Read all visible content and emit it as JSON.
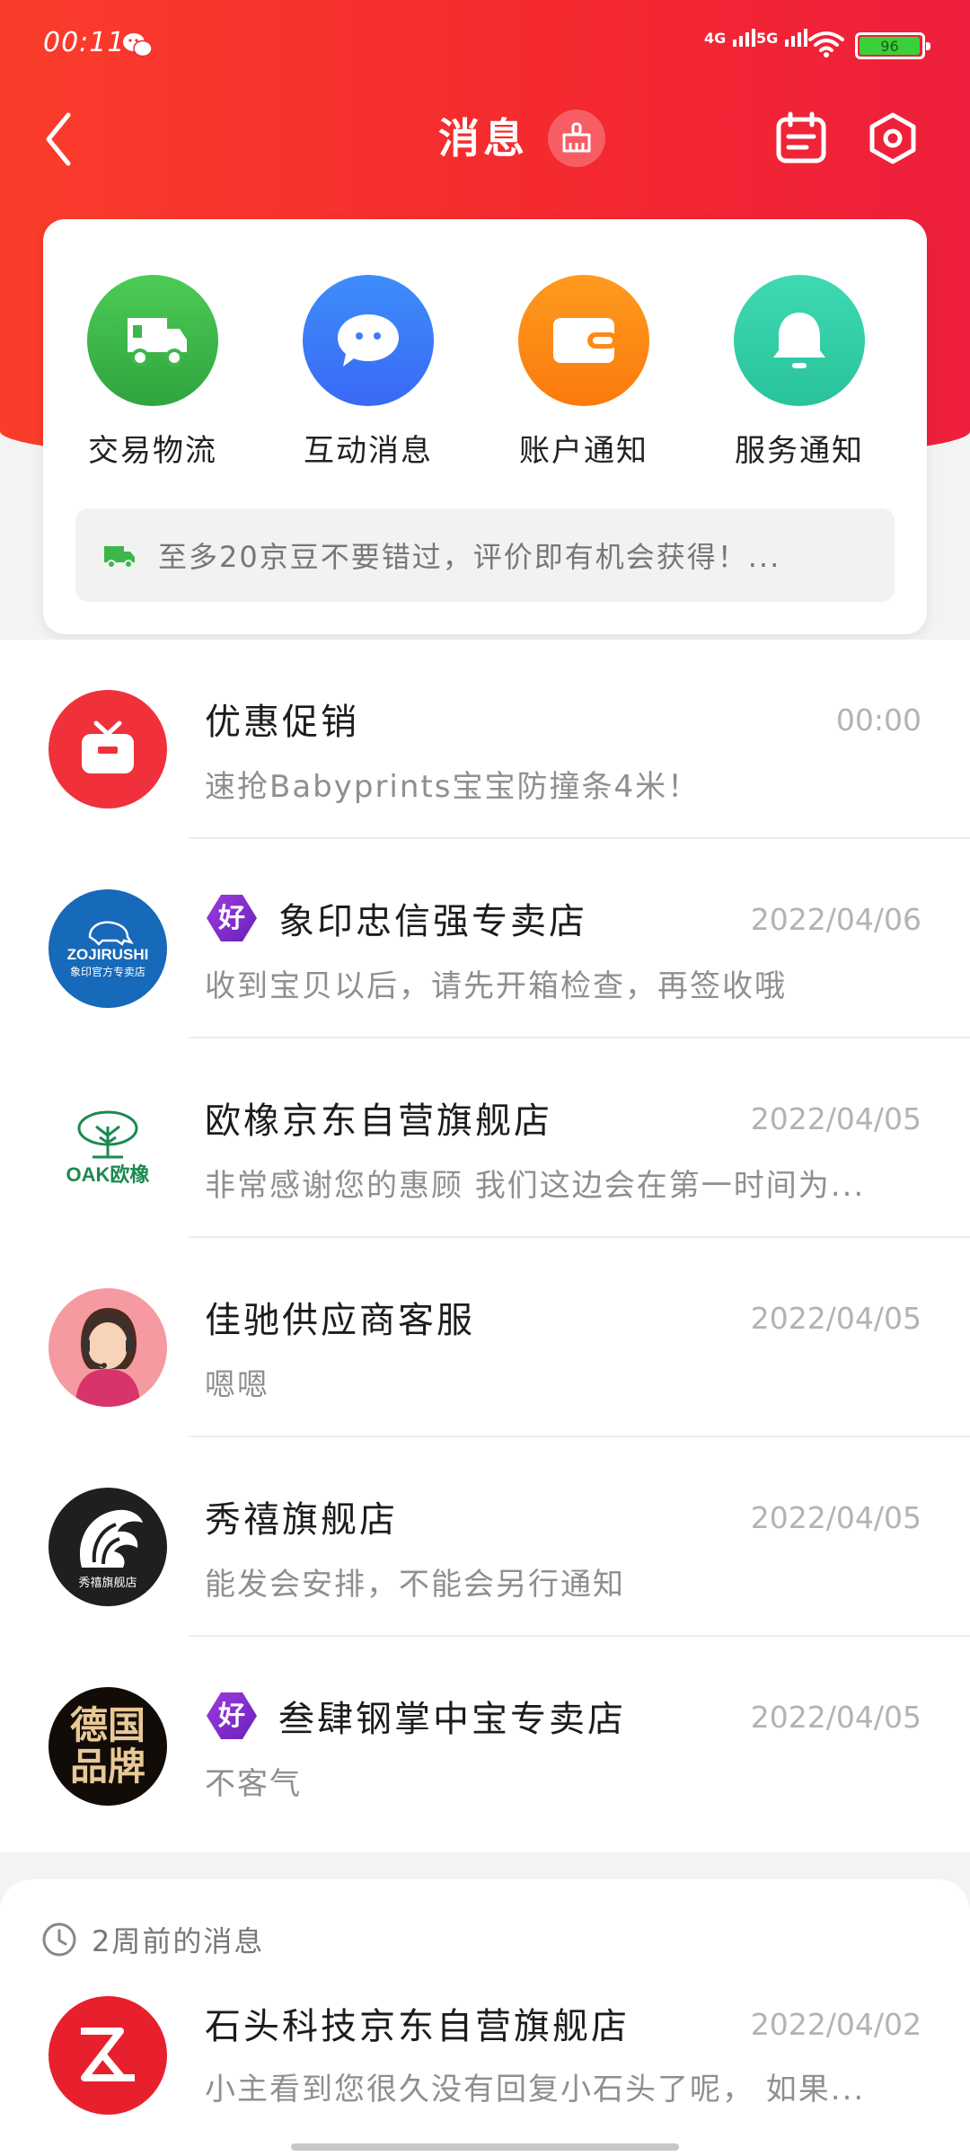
{
  "status_bar": {
    "time": "00:11",
    "network_1": "4G",
    "network_2": "5G",
    "battery": "96"
  },
  "nav": {
    "title": "消息"
  },
  "categories": [
    {
      "label": "交易物流",
      "icon": "truck-icon",
      "color": "#3cb84a"
    },
    {
      "label": "互动消息",
      "icon": "chat-bubble-icon",
      "color": "#3b7ef8"
    },
    {
      "label": "账户通知",
      "icon": "wallet-icon",
      "color": "#fd8a12"
    },
    {
      "label": "服务通知",
      "icon": "bell-icon",
      "color": "#33cfa8"
    }
  ],
  "notice": {
    "text": "至多20京豆不要错过，评价即有机会获得！..."
  },
  "messages": [
    {
      "name": "优惠促销",
      "time": "00:00",
      "preview": "速抢Babyprints宝宝防撞条4米！",
      "avatar": "gift-icon",
      "badge": false
    },
    {
      "name": "象印忠信强专卖店",
      "time": "2022/04/06",
      "preview": "收到宝贝以后，请先开箱检查，再签收哦",
      "avatar": "zojirushi-logo",
      "avatar_text": "ZOJIRUSHI",
      "avatar_subtext": "象印官方专卖店",
      "badge": true,
      "badge_text": "好"
    },
    {
      "name": "欧橡京东自营旗舰店",
      "time": "2022/04/05",
      "preview": "非常感谢您的惠顾 我们这边会在第一时间为...",
      "avatar": "oak-tree-logo",
      "avatar_text": "OAK欧橡",
      "badge": false
    },
    {
      "name": "佳驰供应商客服",
      "time": "2022/04/05",
      "preview": "嗯嗯",
      "avatar": "customer-service-avatar",
      "badge": false
    },
    {
      "name": "秀禧旗舰店",
      "time": "2022/04/05",
      "preview": "能发会安排，不能会另行通知",
      "avatar": "lion-logo",
      "avatar_text": "秀禧旗舰店",
      "badge": false
    },
    {
      "name": "叁肆钢掌中宝专卖店",
      "time": "2022/04/05",
      "preview": "不客气",
      "avatar": "german-brand-logo",
      "avatar_text": "德国品牌",
      "badge": true,
      "badge_text": "好"
    }
  ],
  "older": {
    "label": "2周前的消息",
    "messages": [
      {
        "name": "石头科技京东自营旗舰店",
        "time": "2022/04/02",
        "preview": "小主看到您很久没有回复小石头了呢， 如果...",
        "avatar": "roborock-logo"
      }
    ]
  }
}
